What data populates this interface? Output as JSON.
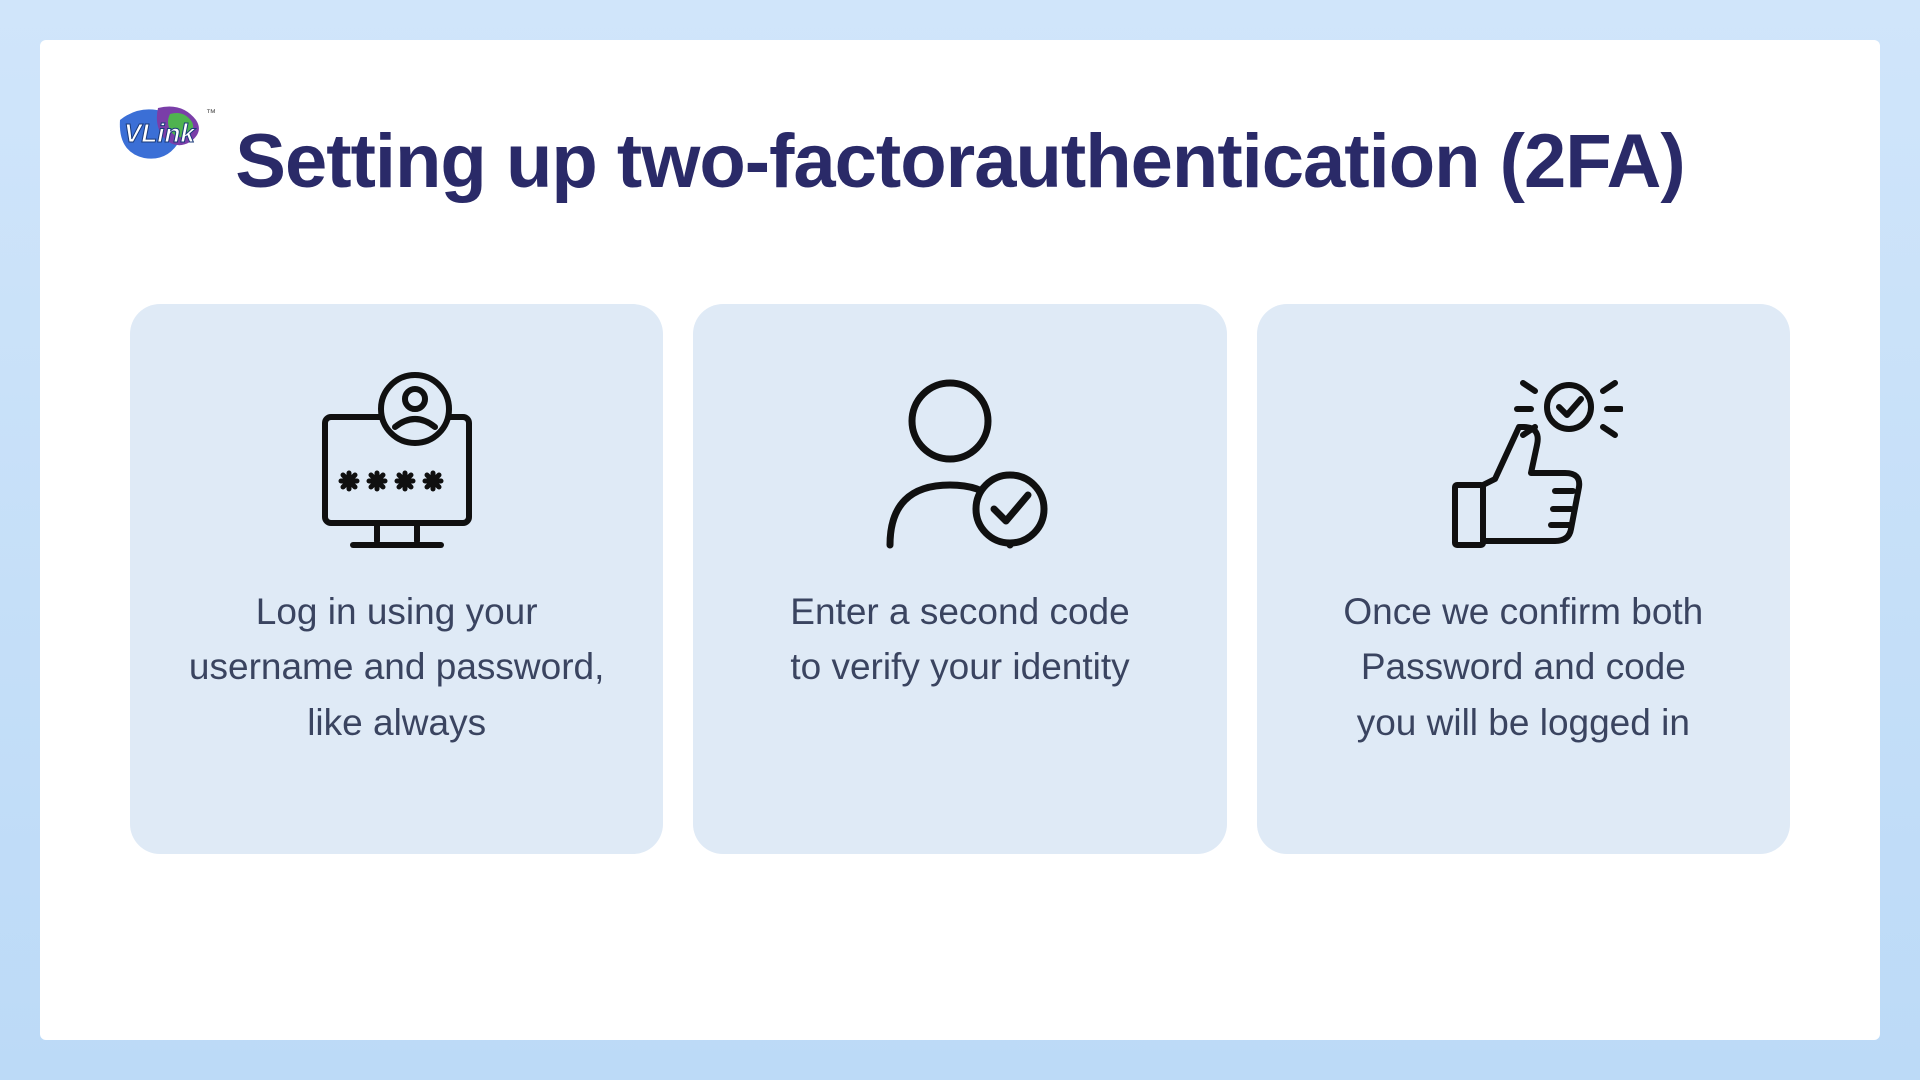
{
  "brand": "VLink",
  "title": "Setting up two-factorauthentication (2FA)",
  "cards": [
    {
      "icon": "login-password-icon",
      "text": "Log in using your\nusername and password,\nlike always"
    },
    {
      "icon": "user-verify-icon",
      "text": "Enter a second code\nto verify your identity"
    },
    {
      "icon": "thumbs-up-check-icon",
      "text": "Once we confirm both\nPassword and code\nyou will be logged in"
    }
  ],
  "colors": {
    "title": "#2a2a68",
    "cardBg": "#dfeaf6",
    "bodyText": "#3a4460",
    "pageBg": "#ffffff",
    "outerBg": "#c9e0f8"
  }
}
